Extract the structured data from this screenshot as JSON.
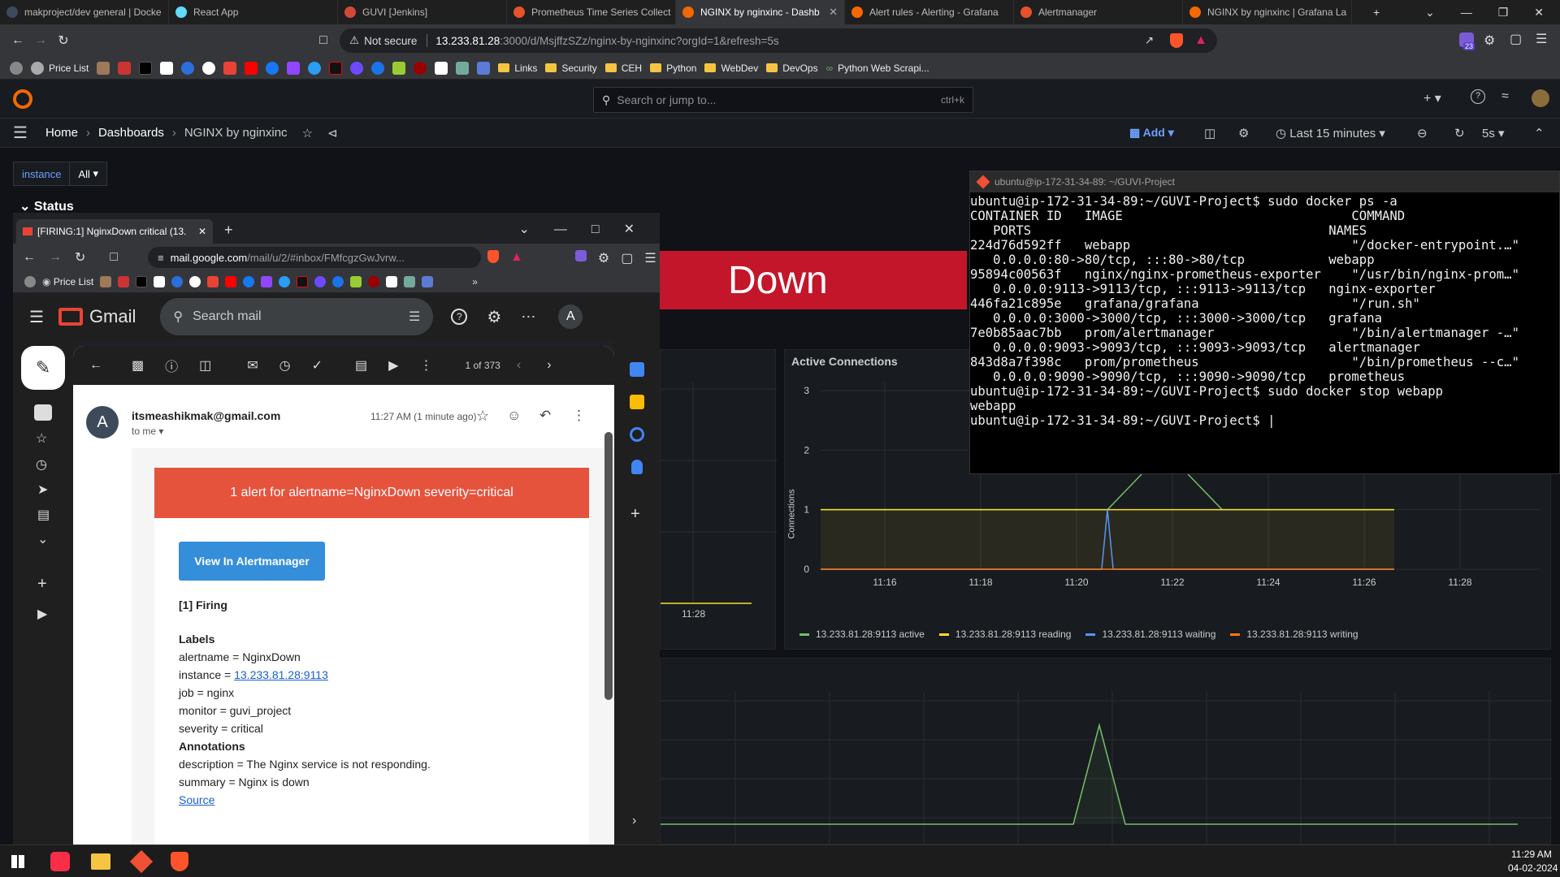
{
  "browser": {
    "tabs": [
      {
        "label": "makproject/dev general | Docke",
        "color": "#3b4a5c"
      },
      {
        "label": "React App",
        "color": "#61dafb"
      },
      {
        "label": "GUVI [Jenkins]",
        "color": "#d24939"
      },
      {
        "label": "Prometheus Time Series Collect",
        "color": "#e6522c"
      },
      {
        "label": "NGINX by nginxinc - Dashb",
        "color": "#f46800"
      },
      {
        "label": "Alert rules - Alerting - Grafana",
        "color": "#f46800"
      },
      {
        "label": "Alertmanager",
        "color": "#e6522c"
      },
      {
        "label": "NGINX by nginxinc | Grafana La",
        "color": "#f46800"
      }
    ],
    "security": "Not secure",
    "url_host": "13.233.81.28",
    "url_path": ":3000/d/MsjffzSZz/nginx-by-nginxinc?orgId=1&refresh=5s",
    "bookmarks": [
      "Price List",
      "Links",
      "Security",
      "CEH",
      "Python",
      "WebDev",
      "DevOps",
      "Python Web Scrapi..."
    ],
    "ext_badge": "23"
  },
  "grafana": {
    "search_placeholder": "Search or jump to...",
    "search_shortcut": "ctrl+k",
    "breadcrumb": [
      "Home",
      "Dashboards",
      "NGINX by nginxinc"
    ],
    "add_label": "Add",
    "time_range": "Last 15 minutes",
    "refresh": "5s",
    "variable_label": "instance",
    "variable_value": "All",
    "row_title": "Status",
    "status_value": "Down",
    "left_axis_tick": "11:28"
  },
  "chart_data": {
    "type": "line",
    "title": "Active Connections",
    "ylabel": "Connections",
    "xlabel": "",
    "x": [
      "11:16",
      "11:18",
      "11:20",
      "11:22",
      "11:24",
      "11:26",
      "11:28"
    ],
    "ylim": [
      0,
      3
    ],
    "yticks": [
      0,
      1,
      2,
      3
    ],
    "series": [
      {
        "name": "13.233.81.28:9113 active",
        "color": "#73bf69",
        "points": [
          [
            0,
            1
          ],
          [
            0.5,
            1
          ],
          [
            0.6,
            2
          ],
          [
            0.7,
            1
          ],
          [
            1,
            1
          ]
        ]
      },
      {
        "name": "13.233.81.28:9113 reading",
        "color": "#fade2a",
        "points": [
          [
            0,
            1
          ],
          [
            1,
            1
          ]
        ]
      },
      {
        "name": "13.233.81.28:9113 waiting",
        "color": "#5794f2",
        "points": [
          [
            0,
            0
          ],
          [
            0.49,
            0
          ],
          [
            0.5,
            1
          ],
          [
            0.51,
            0
          ],
          [
            1,
            0
          ]
        ]
      },
      {
        "name": "13.233.81.28:9113 writing",
        "color": "#ff780a",
        "points": [
          [
            0,
            0
          ],
          [
            1,
            0
          ]
        ]
      }
    ],
    "legend": "bottom"
  },
  "terminal": {
    "title": "ubuntu@ip-172-31-34-89: ~/GUVI-Project",
    "lines": [
      "ubuntu@ip-172-31-34-89:~/GUVI-Project$ sudo docker ps -a",
      "CONTAINER ID   IMAGE                              COMMAND",
      "   PORTS                                       NAMES",
      "224d76d592ff   webapp                             \"/docker-entrypoint.…\"",
      "   0.0.0.0:80->80/tcp, :::80->80/tcp           webapp",
      "95894c00563f   nginx/nginx-prometheus-exporter    \"/usr/bin/nginx-prom…\"",
      "   0.0.0.0:9113->9113/tcp, :::9113->9113/tcp   nginx-exporter",
      "446fa21c895e   grafana/grafana                    \"/run.sh\"",
      "   0.0.0.0:3000->3000/tcp, :::3000->3000/tcp   grafana",
      "7e0b85aac7bb   prom/alertmanager                  \"/bin/alertmanager -…\"",
      "   0.0.0.0:9093->9093/tcp, :::9093->9093/tcp   alertmanager",
      "843d8a7f398c   prom/prometheus                    \"/bin/prometheus --c…\"",
      "   0.0.0.0:9090->9090/tcp, :::9090->9090/tcp   prometheus",
      "ubuntu@ip-172-31-34-89:~/GUVI-Project$ sudo docker stop webapp",
      "webapp",
      "ubuntu@ip-172-31-34-89:~/GUVI-Project$ |"
    ]
  },
  "gmail": {
    "tab_title": "[FIRING:1] NginxDown critical (13.",
    "url_host": "mail.google.com",
    "url_path": "/mail/u/2/#inbox/FMfcgzGwJvrw...",
    "bm_label": "Price List",
    "brand": "Gmail",
    "search_placeholder": "Search mail",
    "avatar": "A",
    "pager": "1 of 373",
    "sender": "itsmeashikmak@gmail.com",
    "recipient": "to me",
    "time": "11:27 AM (1 minute ago)",
    "alert_banner": "1 alert for alertname=NginxDown severity=critical",
    "button": "View In Alertmanager",
    "firing": "[1] Firing",
    "labels_heading": "Labels",
    "label_alertname": "alertname = NginxDown",
    "label_instance_prefix": "instance = ",
    "label_instance_link": "13.233.81.28:9113",
    "label_job": "job = nginx",
    "label_monitor": "monitor = guvi_project",
    "label_severity": "severity = critical",
    "annotations_heading": "Annotations",
    "annotation_description": "description = The Nginx service is not responding.",
    "annotation_summary": "summary = Nginx is down",
    "source": "Source"
  },
  "taskbar": {
    "time": "11:29 AM",
    "date": "04-02-2024"
  }
}
